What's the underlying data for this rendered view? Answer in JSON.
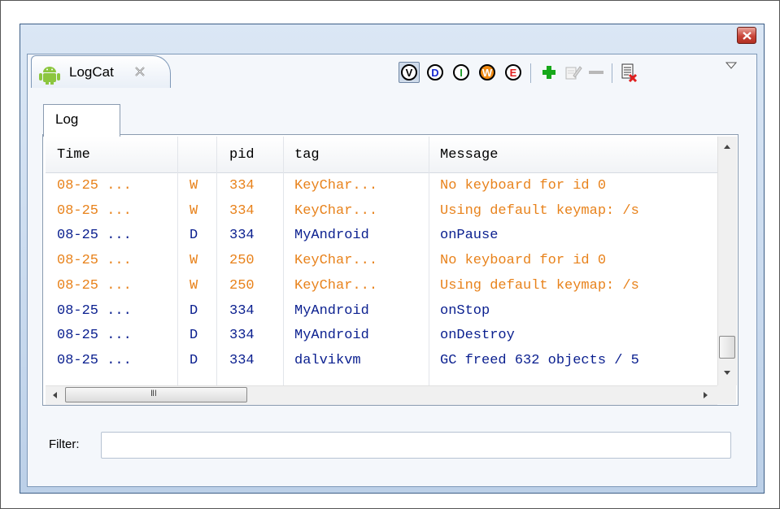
{
  "view": {
    "title": "LogCat",
    "inner_tab": "Log",
    "filter_label": "Filter:",
    "filter_value": "",
    "filter_placeholder": ""
  },
  "toolbar": {
    "verbose": "V",
    "debug": "D",
    "info": "I",
    "warning": "W",
    "error": "E"
  },
  "table": {
    "headers": {
      "time": "Time",
      "level": "",
      "pid": "pid",
      "tag": "tag",
      "message": "Message"
    },
    "rows": [
      {
        "time": "08-25 ...",
        "level": "W",
        "pid": "334",
        "tag": "KeyChar...",
        "message": "No keyboard for id 0"
      },
      {
        "time": "08-25 ...",
        "level": "W",
        "pid": "334",
        "tag": "KeyChar...",
        "message": "Using default keymap: /s"
      },
      {
        "time": "08-25 ...",
        "level": "D",
        "pid": "334",
        "tag": "MyAndroid",
        "message": "onPause"
      },
      {
        "time": "08-25 ...",
        "level": "W",
        "pid": "250",
        "tag": "KeyChar...",
        "message": "No keyboard for id 0"
      },
      {
        "time": "08-25 ...",
        "level": "W",
        "pid": "250",
        "tag": "KeyChar...",
        "message": "Using default keymap: /s"
      },
      {
        "time": "08-25 ...",
        "level": "D",
        "pid": "334",
        "tag": "MyAndroid",
        "message": "onStop"
      },
      {
        "time": "08-25 ...",
        "level": "D",
        "pid": "334",
        "tag": "MyAndroid",
        "message": "onDestroy"
      },
      {
        "time": "08-25 ...",
        "level": "D",
        "pid": "334",
        "tag": "dalvikvm",
        "message": "GC freed 632 objects / 5"
      }
    ]
  },
  "colors": {
    "warning_text": "#e8821b",
    "debug_text": "#0a1f8f",
    "verbose_icon": "#ffffff",
    "debug_icon": "#1a2bd1",
    "info_icon": "#1f9d2a",
    "warning_icon": "#f08a12",
    "error_icon": "#e02020",
    "add_icon": "#17a81a"
  },
  "icons": {
    "tab_icon": "android-icon",
    "tab_close": "close-x-icon",
    "add": "plus-icon",
    "edit": "edit-filter-icon",
    "remove": "minus-icon",
    "clear": "clear-log-icon",
    "menu": "view-menu-triangle-icon"
  }
}
